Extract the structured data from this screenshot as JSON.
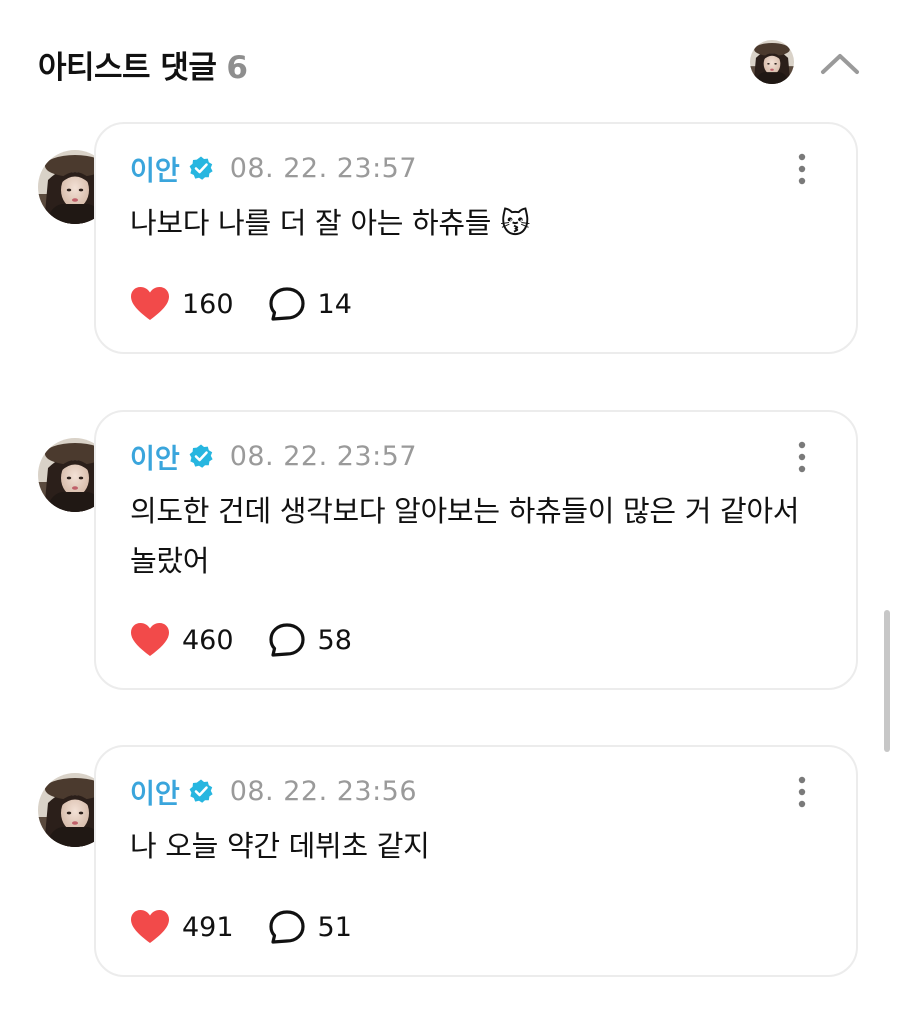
{
  "header": {
    "title": "아티스트 댓글",
    "count": "6"
  },
  "comments": [
    {
      "author": "이안",
      "time": "08. 22. 23:57",
      "text": "나보다 나를 더 잘 아는 하츄들 😽",
      "likes": "160",
      "replies": "14"
    },
    {
      "author": "이안",
      "time": "08. 22. 23:57",
      "text": "의도한 건데 생각보다 알아보는 하츄들이 많은 거 같아서 놀랐어",
      "likes": "460",
      "replies": "58"
    },
    {
      "author": "이안",
      "time": "08. 22. 23:56",
      "text": "나 오늘 약간 데뷔초 같지",
      "likes": "491",
      "replies": "51"
    }
  ],
  "icons": {
    "verified": "verified-badge-icon",
    "like": "heart-icon",
    "reply": "speech-bubble-icon",
    "more": "more-vertical-icon",
    "collapse": "chevron-up-icon"
  },
  "colors": {
    "name": "#3aa5dc",
    "heart": "#f24a4a",
    "verified": "#27b6e0",
    "count_gray": "#8e8e8e"
  }
}
